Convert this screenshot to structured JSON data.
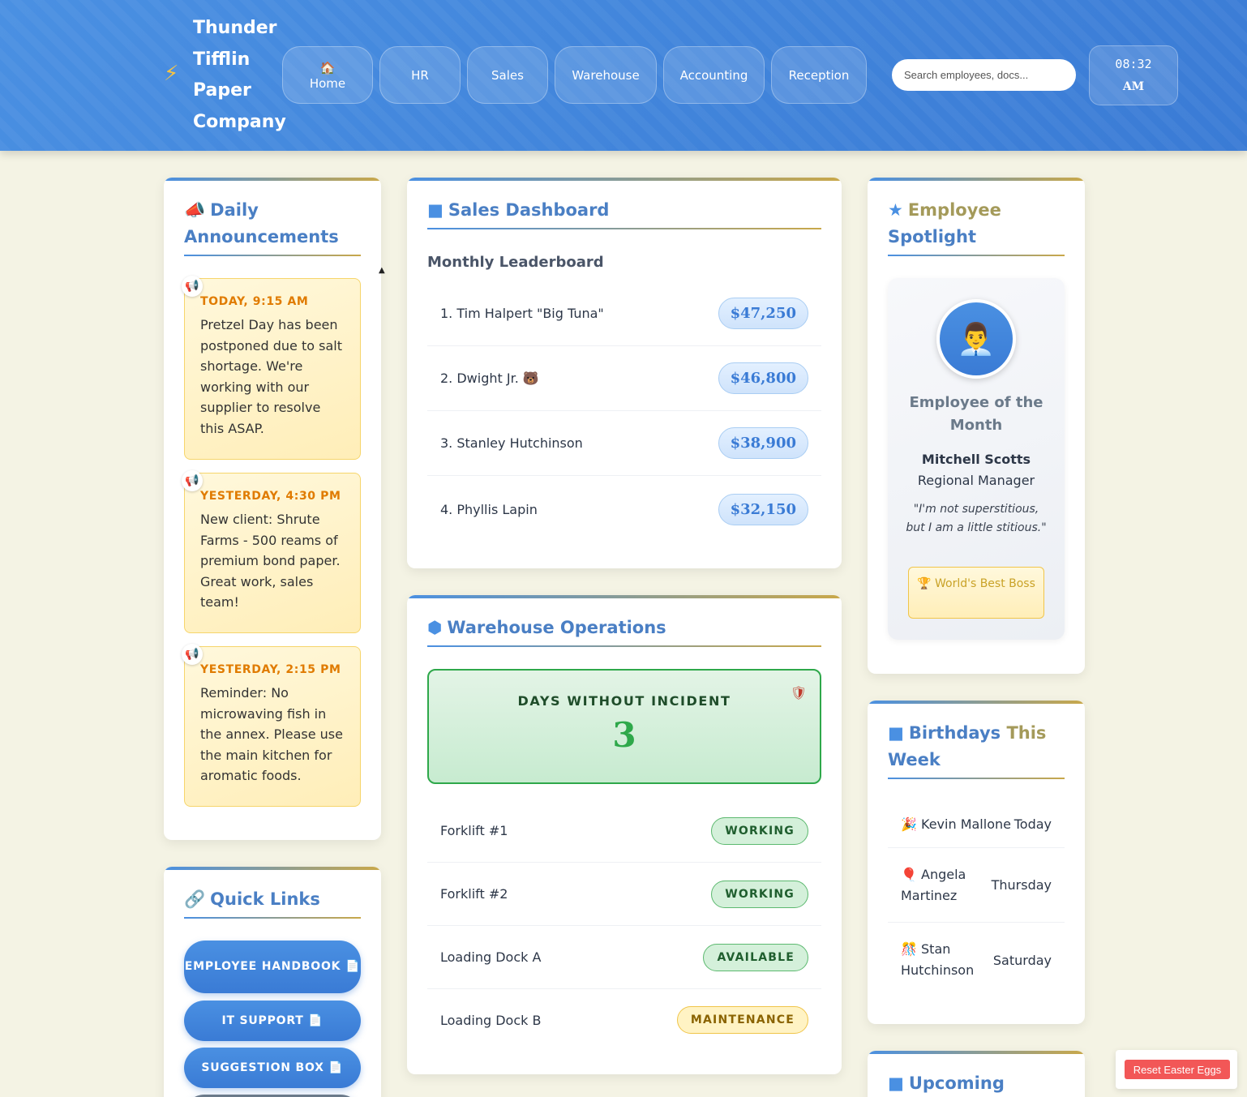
{
  "header": {
    "logo_icon": "⚡",
    "company_name": "Thunder Tifflin Paper Company",
    "nav": [
      {
        "label": "Home",
        "icon": "🏠"
      },
      {
        "label": "HR"
      },
      {
        "label": "Sales"
      },
      {
        "label": "Warehouse"
      },
      {
        "label": "Accounting"
      },
      {
        "label": "Reception"
      }
    ],
    "search_placeholder": "Search employees, docs...",
    "clock_time": "08:32",
    "clock_ampm": "AM"
  },
  "announcements": {
    "title_icon": "📣",
    "title_line1": "Daily",
    "title_line2": "Announcements",
    "items": [
      {
        "when": "TODAY, 9:15 AM",
        "message": "Pretzel Day has been postponed due to salt shortage. We're working with our supplier to resolve this ASAP."
      },
      {
        "when": "YESTERDAY, 4:30 PM",
        "message": "New client: Shrute Farms - 500 reams of premium bond paper. Great work, sales team!"
      },
      {
        "when": "YESTERDAY, 2:15 PM",
        "message": "Reminder: No microwaving fish in the annex. Please use the main kitchen for aromatic foods."
      }
    ]
  },
  "sales": {
    "title": "Sales Dashboard",
    "subtitle": "Monthly Leaderboard",
    "leaders": [
      {
        "name": "1. Tim Halpert \"Big Tuna\"",
        "amount": "$47,250"
      },
      {
        "name": "2. Dwight Jr. 🐻",
        "amount": "$46,800"
      },
      {
        "name": "3. Stanley Hutchinson",
        "amount": "$38,900"
      },
      {
        "name": "4. Phyllis Lapin",
        "amount": "$32,150"
      }
    ]
  },
  "warehouse": {
    "title": "Warehouse Operations",
    "incident_label": "DAYS WITHOUT INCIDENT",
    "incident_days": "3",
    "equipment": [
      {
        "name": "Forklift #1",
        "status": "WORKING",
        "kind": "ok"
      },
      {
        "name": "Forklift #2",
        "status": "WORKING",
        "kind": "ok"
      },
      {
        "name": "Loading Dock A",
        "status": "AVAILABLE",
        "kind": "ok"
      },
      {
        "name": "Loading Dock B",
        "status": "MAINTENANCE",
        "kind": "maint"
      }
    ]
  },
  "spotlight": {
    "title_line1": "Employee",
    "title_line2": "Spotlight",
    "avatar": "👨‍💼",
    "heading": "Employee of the Month",
    "name": "Mitchell Scotts",
    "role": "Regional Manager",
    "quote": "\"I'm not superstitious, but I am a little stitious.\"",
    "award": "🏆 World's Best Boss"
  },
  "birthdays": {
    "title_part1": "Birthdays",
    "title_part2": "This",
    "title_line2": "Week",
    "items": [
      {
        "icon": "🎉",
        "name": "Kevin Mallone",
        "day": "Today"
      },
      {
        "icon": "🎈",
        "name": "Angela Martinez",
        "day": "Thursday"
      },
      {
        "icon": "🎊",
        "name": "Stan Hutchinson",
        "day": "Saturday"
      }
    ]
  },
  "upcoming": {
    "title": "Upcoming"
  },
  "quick_links": {
    "title": "Quick Links",
    "links": [
      {
        "label": "EMPLOYEE HANDBOOK 📄"
      },
      {
        "label": "IT SUPPORT 📄"
      },
      {
        "label": "SUGGESTION BOX 📄"
      }
    ]
  },
  "reset_button": "Reset Easter Eggs"
}
